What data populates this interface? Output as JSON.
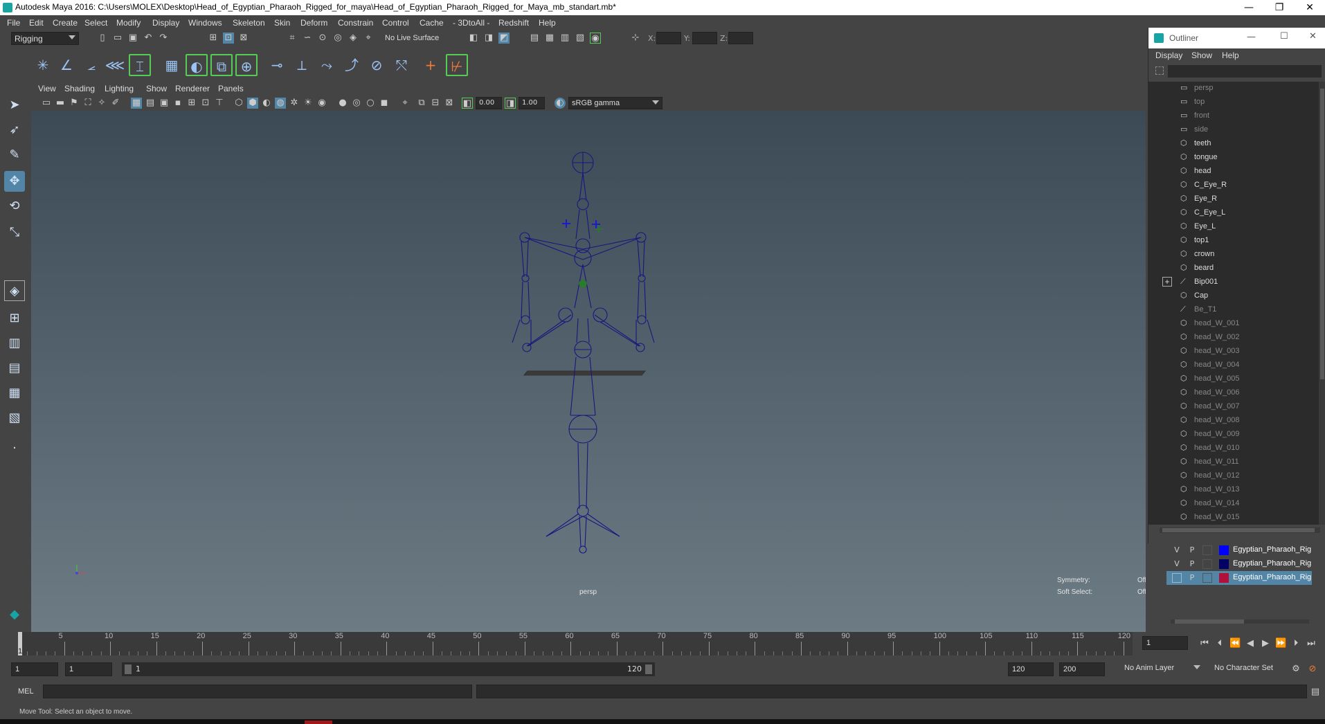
{
  "window": {
    "title": "Autodesk Maya 2016: C:\\Users\\MOLEX\\Desktop\\Head_of_Egyptian_Pharaoh_Rigged_for_maya\\Head_of_Egyptian_Pharaoh_Rigged_for_Maya_mb_standart.mb*"
  },
  "menubar": [
    "File",
    "Edit",
    "Create",
    "Select",
    "Modify",
    "Display",
    "Windows",
    "Skeleton",
    "Skin",
    "Deform",
    "Constrain",
    "Control",
    "Cache",
    "- 3DtoAll -",
    "Redshift",
    "Help"
  ],
  "status_line": {
    "menu_set": "Rigging",
    "live_surface": "No Live Surface",
    "x_label": "X:",
    "y_label": "Y:",
    "z_label": "Z:"
  },
  "viewport": {
    "menus": [
      "View",
      "Shading",
      "Lighting",
      "Show",
      "Renderer",
      "Panels"
    ],
    "exposure": "0.00",
    "gamma": "1.00",
    "color_space": "sRGB gamma",
    "camera_label": "persp",
    "hud": {
      "symmetry_label": "Symmetry:",
      "symmetry_value": "Off",
      "soft_select_label": "Soft Select:",
      "soft_select_value": "Off"
    }
  },
  "outliner": {
    "title": "Outliner",
    "menus": [
      "Display",
      "Show",
      "Help"
    ],
    "items": [
      {
        "label": "persp",
        "icon": "camera-icon",
        "dim": true
      },
      {
        "label": "top",
        "icon": "camera-icon",
        "dim": true
      },
      {
        "label": "front",
        "icon": "camera-icon",
        "dim": true
      },
      {
        "label": "side",
        "icon": "camera-icon",
        "dim": true
      },
      {
        "label": "teeth",
        "icon": "mesh-icon",
        "dim": false
      },
      {
        "label": "tongue",
        "icon": "mesh-icon",
        "dim": false
      },
      {
        "label": "head",
        "icon": "mesh-icon",
        "dim": false
      },
      {
        "label": "C_Eye_R",
        "icon": "mesh-icon",
        "dim": false
      },
      {
        "label": "Eye_R",
        "icon": "mesh-icon",
        "dim": false
      },
      {
        "label": "C_Eye_L",
        "icon": "mesh-icon",
        "dim": false
      },
      {
        "label": "Eye_L",
        "icon": "mesh-icon",
        "dim": false
      },
      {
        "label": "top1",
        "icon": "mesh-icon",
        "dim": false
      },
      {
        "label": "crown",
        "icon": "mesh-icon",
        "dim": false
      },
      {
        "label": "beard",
        "icon": "mesh-icon",
        "dim": false
      },
      {
        "label": "Bip001",
        "icon": "joint-icon",
        "dim": false,
        "expand": true
      },
      {
        "label": "Cap",
        "icon": "mesh-icon",
        "dim": false
      },
      {
        "label": "Be_T1",
        "icon": "joint-icon",
        "dim": true
      },
      {
        "label": "head_W_001",
        "icon": "mesh-icon",
        "dim": true
      },
      {
        "label": "head_W_002",
        "icon": "mesh-icon",
        "dim": true
      },
      {
        "label": "head_W_003",
        "icon": "mesh-icon",
        "dim": true
      },
      {
        "label": "head_W_004",
        "icon": "mesh-icon",
        "dim": true
      },
      {
        "label": "head_W_005",
        "icon": "mesh-icon",
        "dim": true
      },
      {
        "label": "head_W_006",
        "icon": "mesh-icon",
        "dim": true
      },
      {
        "label": "head_W_007",
        "icon": "mesh-icon",
        "dim": true
      },
      {
        "label": "head_W_008",
        "icon": "mesh-icon",
        "dim": true
      },
      {
        "label": "head_W_009",
        "icon": "mesh-icon",
        "dim": true
      },
      {
        "label": "head_W_010",
        "icon": "mesh-icon",
        "dim": true
      },
      {
        "label": "head_W_011",
        "icon": "mesh-icon",
        "dim": true
      },
      {
        "label": "head_W_012",
        "icon": "mesh-icon",
        "dim": true
      },
      {
        "label": "head_W_013",
        "icon": "mesh-icon",
        "dim": true
      },
      {
        "label": "head_W_014",
        "icon": "mesh-icon",
        "dim": true
      },
      {
        "label": "head_W_015",
        "icon": "mesh-icon",
        "dim": true
      }
    ]
  },
  "layers": [
    {
      "v": "V",
      "p": "P",
      "color": "#0000ff",
      "name": "Egyptian_Pharaoh_Rig",
      "selected": false
    },
    {
      "v": "V",
      "p": "P",
      "color": "#000066",
      "name": "Egyptian_Pharaoh_Rig",
      "selected": false
    },
    {
      "v": "",
      "p": "P",
      "color": "#b0103a",
      "name": "Egyptian_Pharaoh_Rig",
      "selected": true
    }
  ],
  "timeline": {
    "ticks": [
      "5",
      "10",
      "15",
      "20",
      "25",
      "30",
      "35",
      "40",
      "45",
      "50",
      "55",
      "60",
      "65",
      "70",
      "75",
      "80",
      "85",
      "90",
      "95",
      "100",
      "105",
      "110",
      "115",
      "120"
    ],
    "first_tick": "1",
    "current_frame": "1"
  },
  "range": {
    "start": "1",
    "playback_start": "1",
    "slider_start": "1",
    "slider_end": "120",
    "playback_end": "120",
    "end": "200",
    "anim_layer": "No Anim Layer",
    "character_set": "No Character Set"
  },
  "mel": {
    "label": "MEL"
  },
  "help_line": "Move Tool: Select an object to move."
}
